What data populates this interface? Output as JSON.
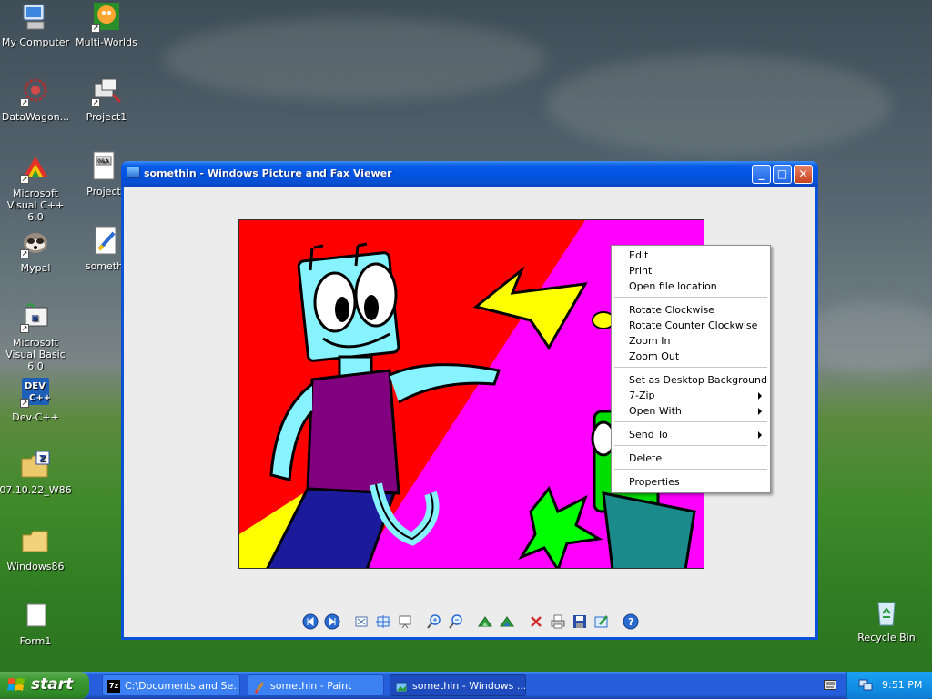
{
  "desktop": {
    "icons": [
      {
        "label": "My Computer",
        "icon": "computer-icon"
      },
      {
        "label": "Multi-Worlds",
        "icon": "app-icon"
      },
      {
        "label": "DataWagon...",
        "icon": "app-icon"
      },
      {
        "label": "Project1",
        "icon": "app-icon"
      },
      {
        "label": "Microsoft Visual C++ 6.0",
        "icon": "app-icon"
      },
      {
        "label": "Project",
        "icon": "document-icon"
      },
      {
        "label": "Mypal",
        "icon": "raccoon-icon"
      },
      {
        "label": "somethi",
        "icon": "image-file-icon"
      },
      {
        "label": "Microsoft Visual Basic 6.0",
        "icon": "app-icon"
      },
      {
        "label": "Dev-C++",
        "icon": "app-icon"
      },
      {
        "label": "07.10.22_W86",
        "icon": "zip-folder-icon"
      },
      {
        "label": "Windows86",
        "icon": "folder-icon"
      },
      {
        "label": "Form1",
        "icon": "document-icon"
      },
      {
        "label": "Recycle Bin",
        "icon": "recycle-bin-icon"
      }
    ]
  },
  "window": {
    "title": "somethin - Windows Picture and Fax Viewer",
    "minimize": "_",
    "maximize": "□",
    "close": "✕"
  },
  "context_menu": {
    "items": [
      {
        "label": "Edit",
        "submenu": false
      },
      {
        "label": "Print",
        "submenu": false
      },
      {
        "label": "Open file location",
        "submenu": false
      },
      {
        "label": "Rotate Clockwise",
        "submenu": false
      },
      {
        "label": "Rotate Counter Clockwise",
        "submenu": false
      },
      {
        "label": "Zoom In",
        "submenu": false
      },
      {
        "label": "Zoom Out",
        "submenu": false
      },
      {
        "label": "Set as Desktop Background",
        "submenu": false
      },
      {
        "label": "7-Zip",
        "submenu": true
      },
      {
        "label": "Open With",
        "submenu": true
      },
      {
        "label": "Send To",
        "submenu": true
      },
      {
        "label": "Delete",
        "submenu": false
      },
      {
        "label": "Properties",
        "submenu": false
      }
    ]
  },
  "toolbar": {
    "buttons": [
      "previous-image-icon",
      "next-image-icon",
      "best-fit-icon",
      "actual-size-icon",
      "slideshow-icon",
      "zoom-in-icon",
      "zoom-out-icon",
      "rotate-clockwise-icon",
      "rotate-counterclockwise-icon",
      "delete-icon",
      "print-icon",
      "save-icon",
      "edit-icon",
      "help-icon"
    ]
  },
  "taskbar": {
    "start_label": "start",
    "tasks": [
      {
        "label": "C:\\Documents and Se...",
        "active": false
      },
      {
        "label": "somethin - Paint",
        "active": false
      },
      {
        "label": "somethin - Windows ...",
        "active": true
      }
    ],
    "clock": "9:51 PM"
  },
  "colors": {
    "titlebar": "#0054e3",
    "start_button": "#3c9b32",
    "taskbar": "#245edb",
    "tray": "#0f8ae0"
  }
}
